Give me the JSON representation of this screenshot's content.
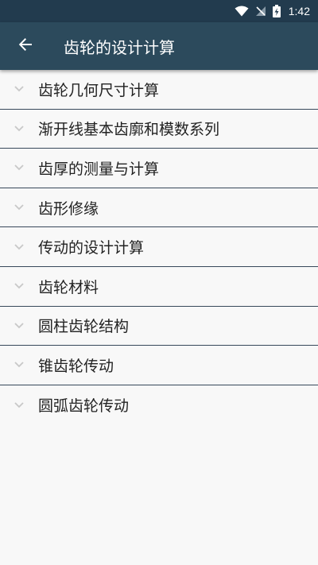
{
  "status_bar": {
    "time": "1:42"
  },
  "app_bar": {
    "title": "齿轮的设计计算"
  },
  "list": {
    "items": [
      {
        "label": "齿轮几何尺寸计算"
      },
      {
        "label": "渐开线基本齿廓和模数系列"
      },
      {
        "label": "齿厚的测量与计算"
      },
      {
        "label": "齿形修缘"
      },
      {
        "label": "传动的设计计算"
      },
      {
        "label": "齿轮材料"
      },
      {
        "label": "圆柱齿轮结构"
      },
      {
        "label": "锥齿轮传动"
      },
      {
        "label": "圆弧齿轮传动"
      }
    ]
  },
  "icons": {
    "back": "arrow-back-icon",
    "expand": "chevron-down-icon",
    "wifi": "wifi-icon",
    "signal": "no-signal-icon",
    "battery": "battery-charging-icon"
  },
  "colors": {
    "status_bar": "#223b4e",
    "app_bar": "#2c4a5c",
    "divider": "#37485a",
    "background": "#f8f8f8",
    "chevron": "#c8c8c8"
  }
}
